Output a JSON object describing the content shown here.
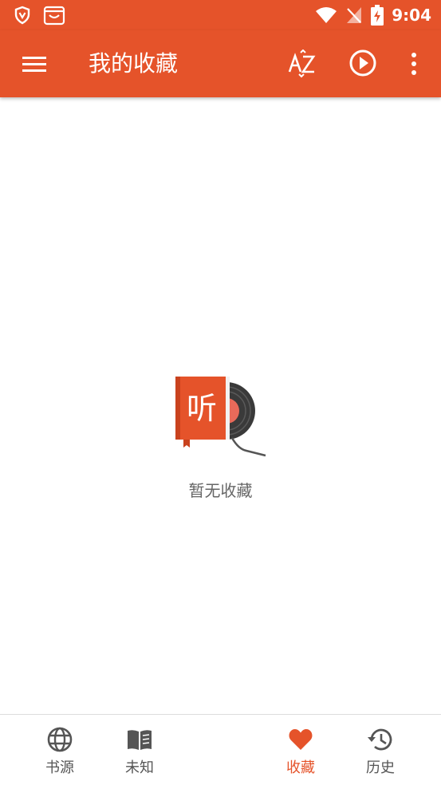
{
  "status_bar": {
    "time": "9:04",
    "left_icons": [
      "shield-icon",
      "app-notification-icon"
    ],
    "right_icons": [
      "wifi-icon",
      "no-signal-icon",
      "battery-charging-icon"
    ]
  },
  "toolbar": {
    "title": "我的收藏",
    "menu_icon": "hamburger-menu-icon",
    "sort_icon": "sort-az-icon",
    "play_icon": "play-circle-icon",
    "more_icon": "more-vert-icon"
  },
  "empty_state": {
    "icon_label": "听",
    "text": "暂无收藏"
  },
  "bottom_nav": {
    "items": [
      {
        "label": "书源",
        "icon": "globe-icon",
        "active": false
      },
      {
        "label": "未知",
        "icon": "book-icon",
        "active": false
      },
      {
        "label": "收藏",
        "icon": "heart-icon",
        "active": true
      },
      {
        "label": "历史",
        "icon": "history-icon",
        "active": false
      }
    ]
  },
  "colors": {
    "accent": "#e5532a",
    "inactive": "#555555",
    "empty_text": "#666666",
    "background": "#ffffff"
  }
}
